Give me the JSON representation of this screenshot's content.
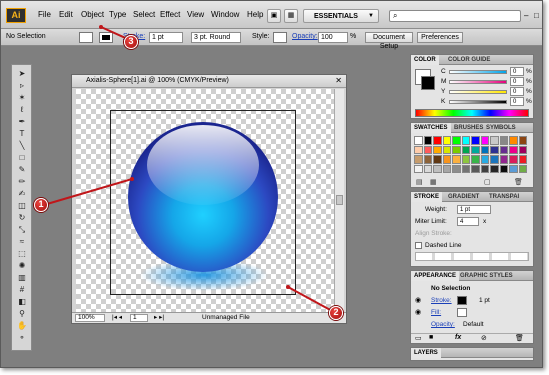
{
  "menubar": {
    "logo": "Ai",
    "items": [
      "File",
      "Edit",
      "Object",
      "Type",
      "Select",
      "Effect",
      "View",
      "Window",
      "Help"
    ],
    "workspace": "ESSENTIALS",
    "window_controls": [
      "–",
      "□",
      "✕"
    ]
  },
  "controlbar": {
    "selection": "No Selection",
    "stroke_label": "Stroke:",
    "stroke_value": "1 pt",
    "brush_value": "3 pt. Round",
    "style_label": "Style:",
    "opacity_label": "Opacity:",
    "opacity_value": "100",
    "percent": "%",
    "doc_setup": "Document Setup",
    "preferences": "Preferences"
  },
  "document": {
    "title": "Axialis-Sphere[1].ai @ 100% (CMYK/Preview)",
    "zoom": "100%",
    "page": "1",
    "status": "Unmanaged File"
  },
  "panels": {
    "color": {
      "tabs": [
        "COLOR",
        "COLOR GUIDE"
      ],
      "channels": [
        {
          "label": "C",
          "value": "0",
          "percent": "%"
        },
        {
          "label": "M",
          "value": "0",
          "percent": "%"
        },
        {
          "label": "Y",
          "value": "0",
          "percent": "%"
        },
        {
          "label": "K",
          "value": "0",
          "percent": "%"
        }
      ]
    },
    "swatches": {
      "tabs": [
        "SWATCHES",
        "BRUSHES",
        "SYMBOLS"
      ]
    },
    "stroke": {
      "tabs": [
        "STROKE",
        "GRADIENT",
        "TRANSPAI"
      ],
      "weight_label": "Weight:",
      "weight_value": "1 pt",
      "miter_label": "Miter Limit:",
      "miter_value": "4",
      "x_label": "x",
      "align_label": "Align Stroke:",
      "dashed_label": "Dashed Line"
    },
    "appearance": {
      "tabs": [
        "APPEARANCE",
        "GRAPHIC STYLES"
      ],
      "header": "No Selection",
      "stroke_label": "Stroke:",
      "stroke_value": "1 pt",
      "fill_label": "Fill:",
      "opacity_label": "Opacity:",
      "opacity_value": "Default",
      "fx": "fx"
    },
    "layers": {
      "tabs": [
        "LAYERS"
      ]
    }
  },
  "callouts": [
    "1",
    "2",
    "3"
  ],
  "colors": {
    "callout_red": "#c0161a",
    "sphere_blue": "#2b3fb0",
    "sphere_cyan": "#14b8ee",
    "link_blue": "#1a3fb8"
  }
}
